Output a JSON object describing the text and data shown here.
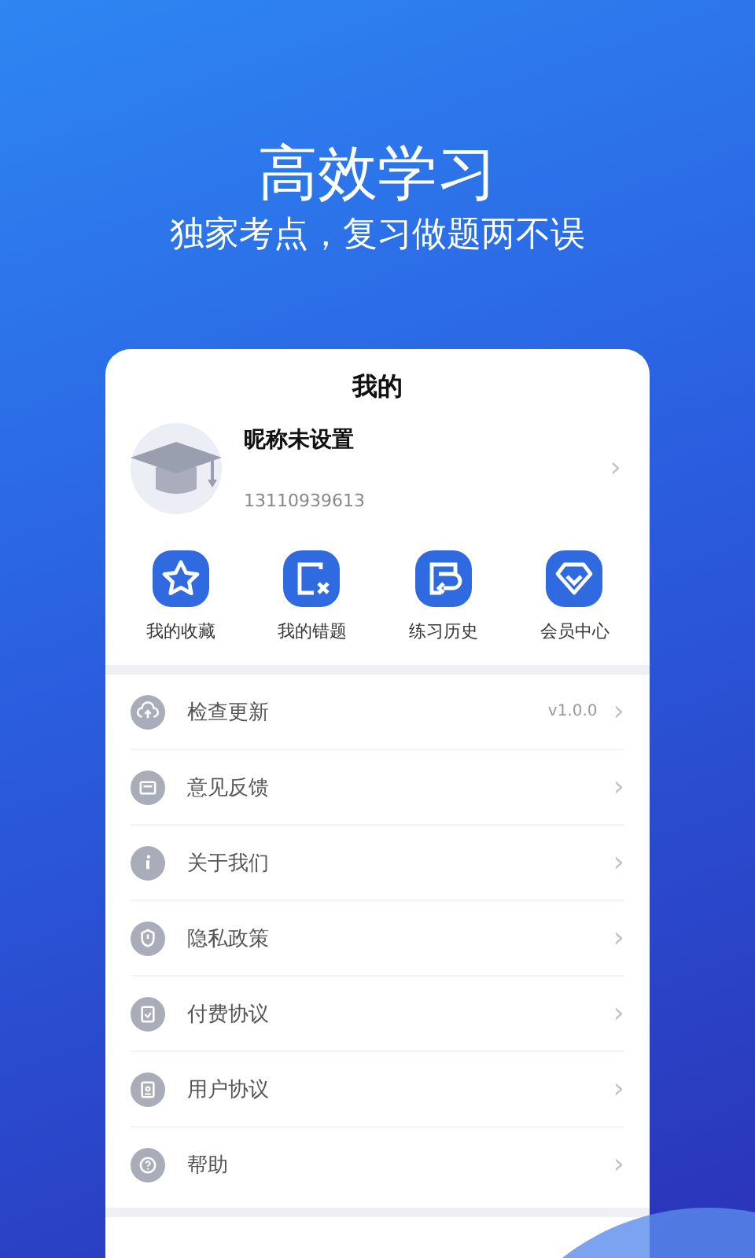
{
  "headline": "高效学习",
  "subtitle": "独家考点，复习做题两不误",
  "card": {
    "title": "我的",
    "profile": {
      "nickname": "昵称未设置",
      "phone": "13110939613",
      "arrow": "›"
    },
    "shortcuts": [
      {
        "label": "我的收藏"
      },
      {
        "label": "我的错题"
      },
      {
        "label": "练习历史"
      },
      {
        "label": "会员中心"
      }
    ],
    "menu": [
      {
        "label": "检查更新",
        "value": "v1.0.0",
        "arrow": "›"
      },
      {
        "label": "意见反馈",
        "arrow": "›"
      },
      {
        "label": "关于我们",
        "arrow": "›"
      },
      {
        "label": "隐私政策",
        "arrow": "›"
      },
      {
        "label": "付费协议",
        "arrow": "›"
      },
      {
        "label": "用户协议",
        "arrow": "›"
      },
      {
        "label": "帮助",
        "arrow": "›"
      }
    ]
  }
}
